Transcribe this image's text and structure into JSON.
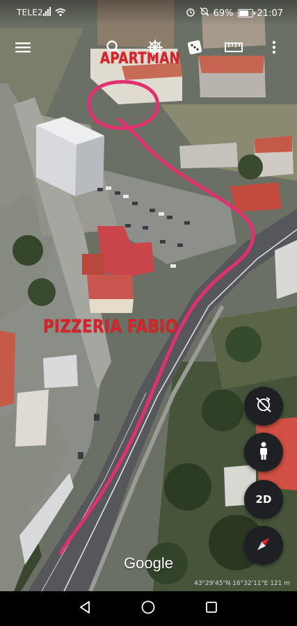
{
  "status_bar": {
    "carrier": "TELE2",
    "battery": "69%",
    "time": "21:07"
  },
  "toolbar": {
    "icons": [
      "menu-icon",
      "search-icon",
      "ship-wheel-icon",
      "dice-icon",
      "ruler-icon",
      "more-vert-icon"
    ]
  },
  "annotations": {
    "apartment": "APARTMAN",
    "pizzeria": "PIZZERIA FABIO"
  },
  "map_controls": {
    "view_mode": "2D",
    "icons": [
      "reset-rotation-icon",
      "street-view-person-icon",
      "compass-icon"
    ]
  },
  "footer": {
    "logo": "Google",
    "coordinates": "43°29'45\"N 16°32'11\"E 121 m"
  },
  "route_color": "#e0306d",
  "annotation_color": "#d8232a"
}
